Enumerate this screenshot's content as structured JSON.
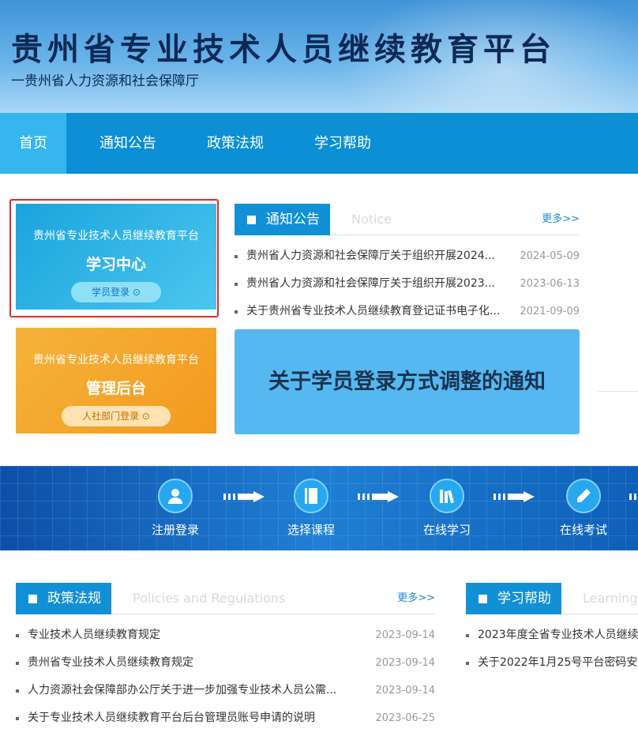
{
  "header": {
    "title": "贵州省专业技术人员继续教育平台",
    "subtitle": "一贵州省人力资源和社会保障厅"
  },
  "nav": [
    {
      "label": "首页"
    },
    {
      "label": "通知公告"
    },
    {
      "label": "政策法规"
    },
    {
      "label": "学习帮助"
    }
  ],
  "cards": {
    "study": {
      "title": "贵州省专业技术人员继续教育平台",
      "name": "学习中心",
      "button": "学员登录 ⊙"
    },
    "admin": {
      "title": "贵州省专业技术人员继续教育平台",
      "name": "管理后台",
      "button": "人社部门登录 ⊙"
    }
  },
  "notice": {
    "title": "通知公告",
    "en": "Notice",
    "more": "更多>>",
    "items": [
      {
        "text": "贵州省人力资源和社会保障厅关于组织开展2024...",
        "date": "2024-05-09"
      },
      {
        "text": "贵州省人力资源和社会保障厅关于组织开展2023...",
        "date": "2023-06-13"
      },
      {
        "text": "关于贵州省专业技术人员继续教育登记证书电子化...",
        "date": "2021-09-09"
      }
    ]
  },
  "banner": {
    "text": "关于学员登录方式调整的通知"
  },
  "process": [
    {
      "label": "注册登录",
      "icon": "user-icon"
    },
    {
      "label": "选择课程",
      "icon": "book-icon"
    },
    {
      "label": "在线学习",
      "icon": "books-icon"
    },
    {
      "label": "在线考试",
      "icon": "pencil-icon"
    }
  ],
  "policy": {
    "title": "政策法规",
    "en": "Policies and Regulations",
    "more": "更多>>",
    "items": [
      {
        "text": "专业技术人员继续教育规定",
        "date": "2023-09-14"
      },
      {
        "text": "贵州省专业技术人员继续教育规定",
        "date": "2023-09-14"
      },
      {
        "text": "人力资源社会保障部办公厅关于进一步加强专业技术人员公需...",
        "date": "2023-09-14"
      },
      {
        "text": "关于专业技术人员继续教育平台后台管理员账号申请的说明",
        "date": "2023-06-25"
      }
    ]
  },
  "help": {
    "title": "学习帮助",
    "en": "Learning",
    "items": [
      {
        "text": "2023年度全省专业技术人员继续"
      },
      {
        "text": "关于2022年1月25号平台密码安"
      }
    ]
  },
  "colors": {
    "nav": "#0c8fd4",
    "nav_active": "#35b6ee",
    "highlight": "#e12b2b"
  }
}
